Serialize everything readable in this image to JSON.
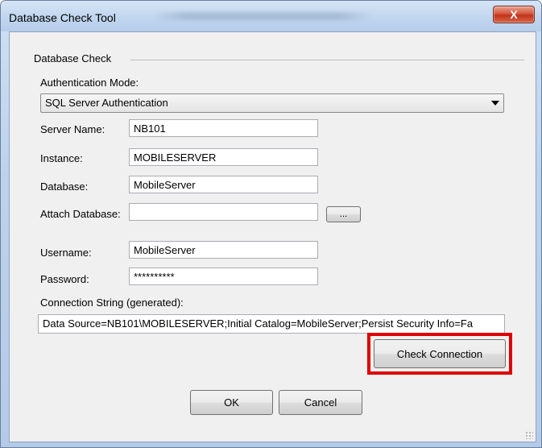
{
  "window": {
    "title": "Database Check Tool",
    "close_glyph": "X"
  },
  "group": {
    "label": "Database Check"
  },
  "auth": {
    "label": "Authentication Mode:",
    "selected": "SQL Server Authentication"
  },
  "fields": {
    "server_name": {
      "label": "Server Name:",
      "value": "NB101"
    },
    "instance": {
      "label": "Instance:",
      "value": "MOBILESERVER"
    },
    "database": {
      "label": "Database:",
      "value": "MobileServer"
    },
    "attach_database": {
      "label": "Attach Database:",
      "value": ""
    },
    "username": {
      "label": "Username:",
      "value": "MobileServer"
    },
    "password": {
      "label": "Password:",
      "value": "**********"
    }
  },
  "browse_button": {
    "label": "..."
  },
  "connection_string": {
    "label": "Connection String (generated):",
    "value": "Data Source=NB101\\MOBILESERVER;Initial Catalog=MobileServer;Persist Security Info=Fa"
  },
  "buttons": {
    "check_connection": "Check Connection",
    "ok": "OK",
    "cancel": "Cancel"
  },
  "colors": {
    "highlight": "#e00000",
    "close_button": "#c0331b"
  }
}
